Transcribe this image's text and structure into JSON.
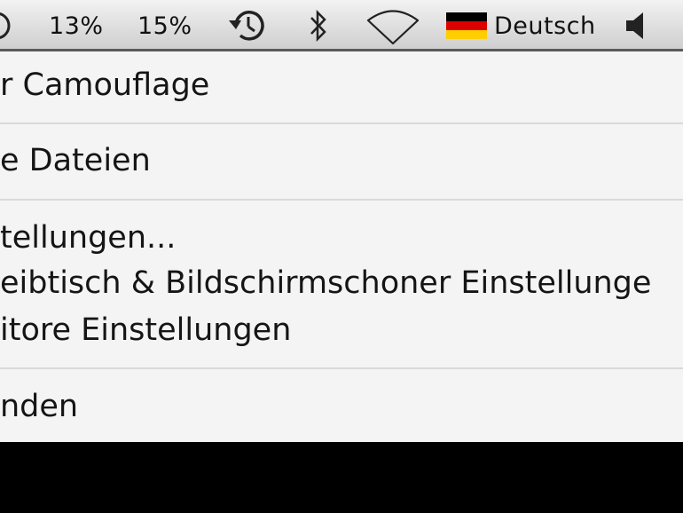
{
  "menubar": {
    "battery_pct": "13%",
    "cpu_pct": "15%",
    "input_language": "Deutsch",
    "icons": [
      "partial-status-icon",
      "time-machine-icon",
      "bluetooth-icon",
      "wifi-icon",
      "german-flag-icon",
      "volume-icon"
    ]
  },
  "menu": {
    "items": [
      "r Camouflage",
      "e Dateien",
      "tellungen...",
      "eibtisch & Bildschirmschoner Einstellunge",
      "itore Einstellungen",
      "nden"
    ]
  },
  "colors": {
    "menu_background": "#f4f4f4",
    "separator": "#dadada",
    "menubar_border": "#5a5a5a",
    "flag_black": "#000000",
    "flag_red": "#dd0000",
    "flag_gold": "#ffce00"
  }
}
